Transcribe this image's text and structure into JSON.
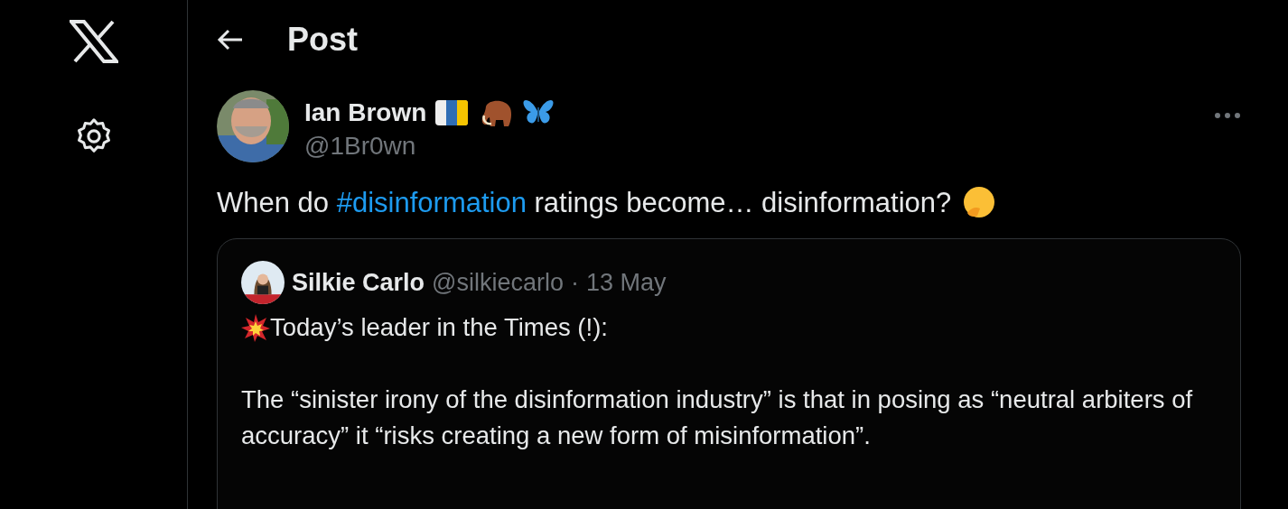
{
  "sidebar": {
    "items": [
      {
        "kind": "logo"
      },
      {
        "kind": "settings"
      }
    ]
  },
  "header": {
    "title": "Post"
  },
  "post": {
    "author_name": "Ian Brown",
    "badges": [
      {
        "kind": "flag"
      },
      {
        "kind": "mammoth"
      },
      {
        "kind": "butterfly"
      }
    ],
    "handle": "@1Br0wn",
    "text": [
      {
        "kind": "text",
        "text": "When do "
      },
      {
        "kind": "hashtag",
        "text": "#disinformation"
      },
      {
        "kind": "text",
        "text": " ratings become… disinformation?"
      },
      {
        "kind": "emoji"
      }
    ],
    "quote": {
      "author_name": "Silkie Carlo",
      "handle": "@silkiecarlo",
      "separator": "·",
      "date": "13 May",
      "paragraphs": [
        {
          "emoji": true,
          "text": "Today’s leader in the Times (!):"
        },
        {
          "emoji": false,
          "text": "The “sinister irony of the disinformation industry” is that in posing as “neutral arbiters of accuracy” it “risks creating a new form of misinformation”."
        }
      ]
    }
  }
}
